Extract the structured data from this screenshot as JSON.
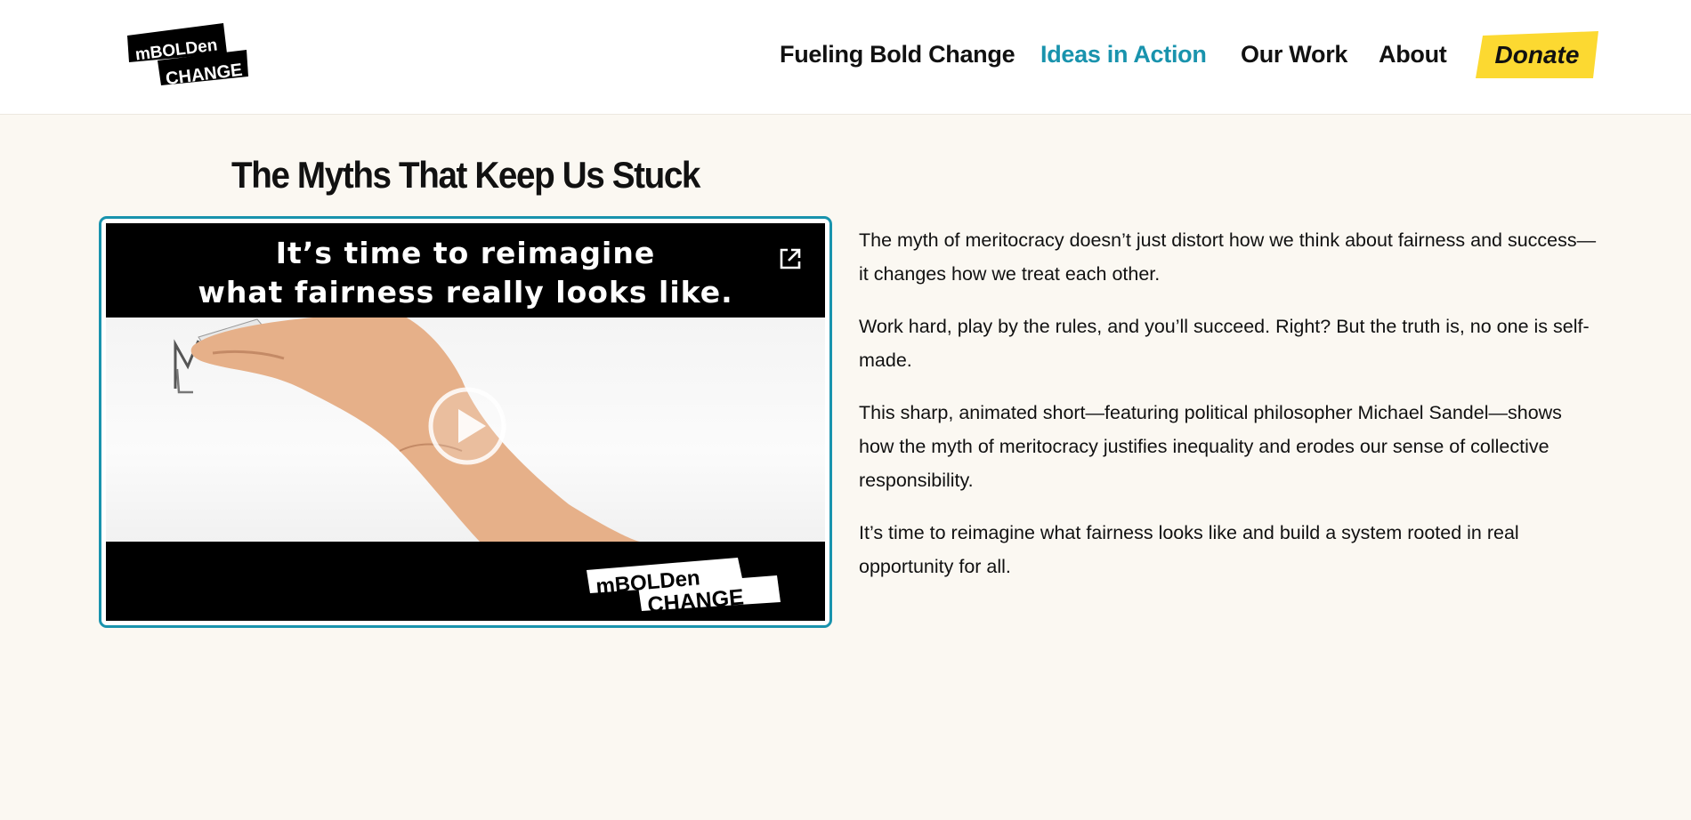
{
  "header": {
    "logo": {
      "line1": "mBOLDen",
      "line2": "CHANGE"
    },
    "nav": [
      {
        "label": "Fueling Bold Change",
        "active": false
      },
      {
        "label": "Ideas in Action",
        "active": true
      },
      {
        "label": "Our Work",
        "active": false
      },
      {
        "label": "About",
        "active": false
      }
    ],
    "donate_label": "Donate",
    "colors": {
      "accent": "#1993ad",
      "donate_bg": "#fcd931"
    }
  },
  "main": {
    "title": "The Myths That Keep Us Stuck",
    "video": {
      "caption_line1": "It’s time to reimagine",
      "caption_line2": "what fairness really looks like.",
      "external_icon": "external-link-icon",
      "play_icon": "play-icon",
      "logo": {
        "line1": "mBOLDen",
        "line2": "CHANGE"
      }
    },
    "paragraphs": [
      "The myth of meritocracy doesn’t just distort how we think about fairness and success—it changes how we treat each other.",
      "Work hard, play by the rules, and you’ll succeed. Right? But the truth is, no one is self-made.",
      "This sharp, animated short—featuring political philosopher Michael Sandel—shows how the myth of meritocracy justifies inequality and erodes our sense of collective responsibility.",
      "It’s time to reimagine what fairness looks like and build a system rooted in real opportunity for all."
    ]
  }
}
